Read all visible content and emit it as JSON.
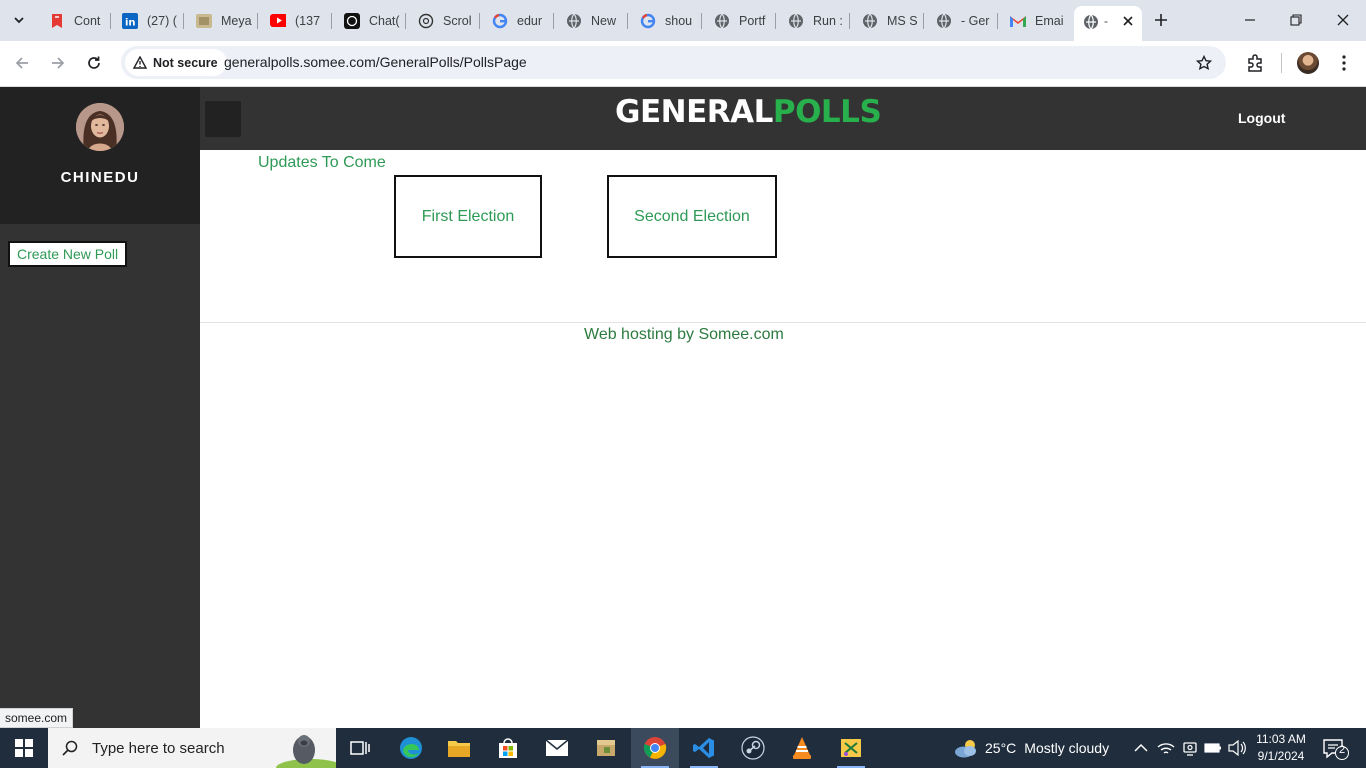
{
  "browser": {
    "tabs": [
      {
        "title": "Cont",
        "icon": "pdf-icon"
      },
      {
        "title": "(27) (",
        "icon": "linkedin-icon"
      },
      {
        "title": "Meya",
        "icon": "image-icon"
      },
      {
        "title": "(137",
        "icon": "youtube-icon"
      },
      {
        "title": "Chat(",
        "icon": "chatgpt-icon"
      },
      {
        "title": "Scrol",
        "icon": "chatgpt-icon"
      },
      {
        "title": "edur",
        "icon": "google-icon"
      },
      {
        "title": "New",
        "icon": "globe-icon"
      },
      {
        "title": "shou",
        "icon": "google-icon"
      },
      {
        "title": "Portf",
        "icon": "globe-icon"
      },
      {
        "title": "Run :",
        "icon": "globe-icon"
      },
      {
        "title": "MS S",
        "icon": "globe-icon"
      },
      {
        "title": "- Ger",
        "icon": "globe-icon"
      },
      {
        "title": "Emai",
        "icon": "gmail-icon"
      }
    ],
    "active_tab": {
      "title": "-",
      "icon": "globe-icon"
    },
    "security_label": "Not secure",
    "url": "generalpolls.somee.com/GeneralPolls/PollsPage",
    "status_url": "somee.com"
  },
  "page": {
    "brand_part1": "GENERAL",
    "brand_part2": "POLLS",
    "logout_label": "Logout",
    "username": "CHINEDU",
    "create_poll_label": "Create New Poll",
    "updates_label": "Updates To Come",
    "elections": [
      {
        "label": "First Election"
      },
      {
        "label": "Second Election"
      }
    ],
    "footer_text": "Web hosting by Somee.com",
    "colors": {
      "accent": "#27b04b",
      "link": "#2e9a55",
      "header_bg": "#333333",
      "sidebar_bg": "#333333"
    }
  },
  "taskbar": {
    "search_placeholder": "Type here to search",
    "weather_temp": "25°C",
    "weather_desc": "Mostly cloudy",
    "time": "11:03 AM",
    "date": "9/1/2024",
    "notification_count": "2"
  }
}
